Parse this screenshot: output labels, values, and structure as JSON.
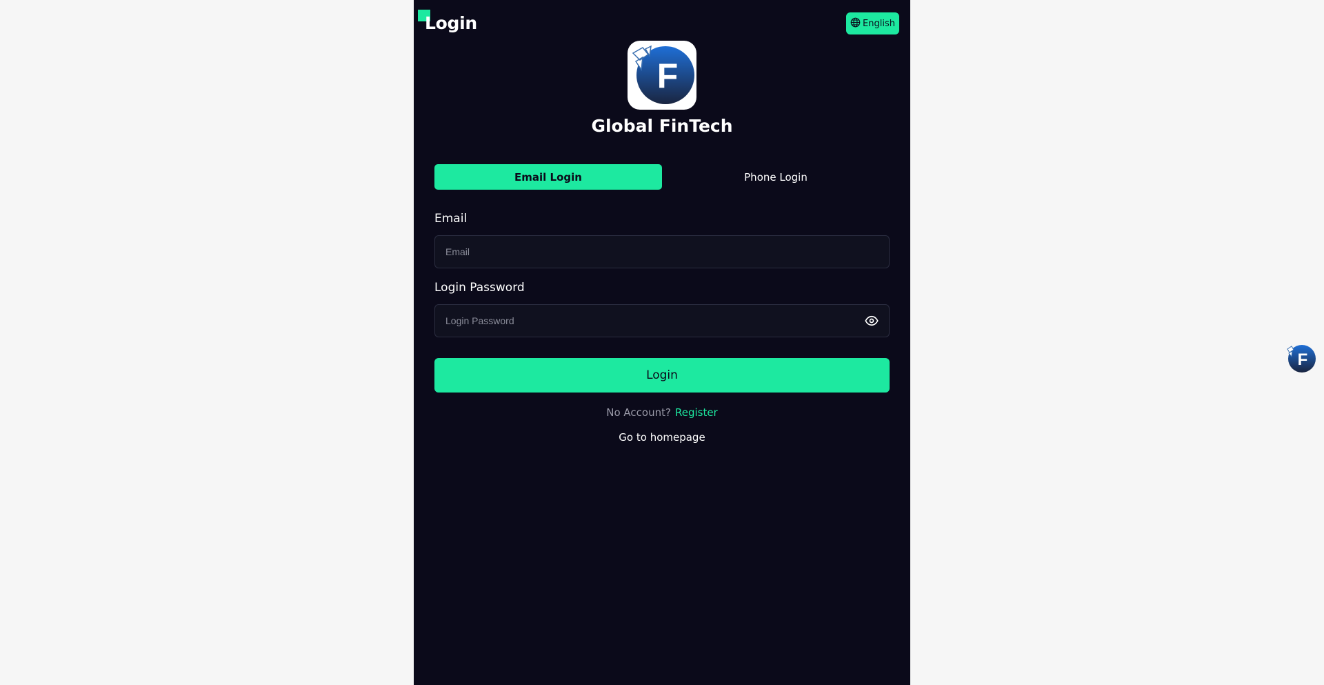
{
  "header": {
    "title": "Login",
    "language": "English"
  },
  "brand": {
    "logo_letter": "F",
    "name": "Global FinTech"
  },
  "tabs": [
    {
      "label": "Email Login",
      "active": true
    },
    {
      "label": "Phone Login",
      "active": false
    }
  ],
  "form": {
    "email_label": "Email",
    "email_placeholder": "Email",
    "email_value": "",
    "password_label": "Login Password",
    "password_placeholder": "Login Password",
    "password_value": "",
    "submit_label": "Login"
  },
  "footer": {
    "no_account_text": "No Account?",
    "register_link": "Register",
    "home_link": "Go to homepage"
  },
  "floating": {
    "logo_letter": "F"
  },
  "colors": {
    "accent": "#1de9a0",
    "panel_bg": "#0b0a1a",
    "page_bg": "#f6f6f6"
  },
  "icons": [
    "globe-icon",
    "eye-icon"
  ]
}
